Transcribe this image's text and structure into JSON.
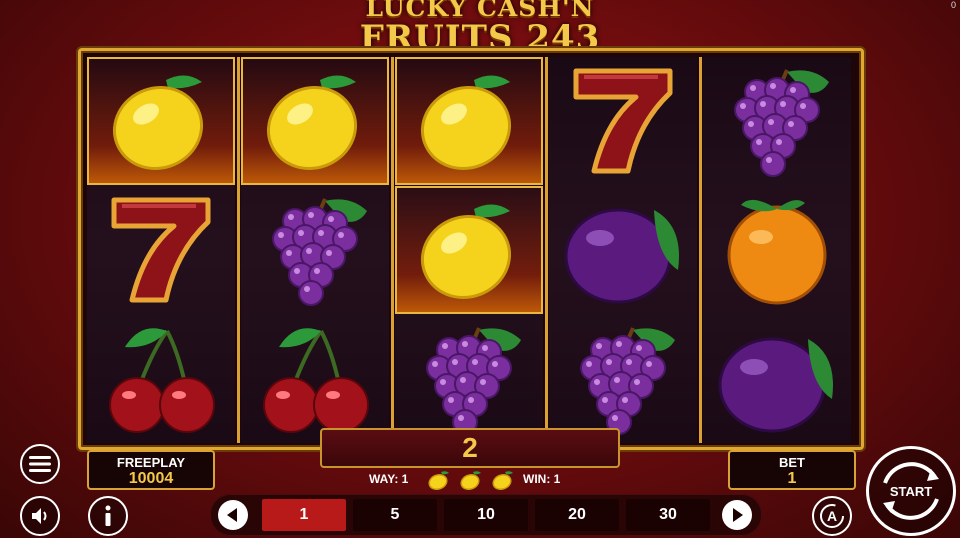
{
  "game": {
    "title_line1": "LUCKY CASH'N",
    "title_line2": "FRUITS 243",
    "corner_value": "0"
  },
  "reels": [
    {
      "symbols": [
        "lemon-icon",
        "seven-icon",
        "cherry-icon"
      ],
      "winning": [
        true,
        false,
        false
      ]
    },
    {
      "symbols": [
        "lemon-icon",
        "grapes-icon",
        "cherry-icon"
      ],
      "winning": [
        true,
        false,
        false
      ]
    },
    {
      "symbols": [
        "lemon-icon",
        "lemon-icon",
        "grapes-icon"
      ],
      "winning": [
        true,
        true,
        false
      ]
    },
    {
      "symbols": [
        "seven-icon",
        "plum-icon",
        "grapes-icon"
      ],
      "winning": [
        false,
        false,
        false
      ]
    },
    {
      "symbols": [
        "grapes-icon",
        "orange-icon",
        "plum-icon"
      ],
      "winning": [
        false,
        false,
        false
      ]
    }
  ],
  "win": {
    "amount": "2"
  },
  "win_info": {
    "way_label": "WAY: 1",
    "win_label": "WIN: 1",
    "symbol_count": 3
  },
  "freeplay": {
    "label": "FREEPLAY",
    "value": "10004"
  },
  "bet": {
    "label": "BET",
    "value": "1"
  },
  "bet_options": [
    {
      "label": "1",
      "active": true
    },
    {
      "label": "5",
      "active": false
    },
    {
      "label": "10",
      "active": false
    },
    {
      "label": "20",
      "active": false
    },
    {
      "label": "30",
      "active": false
    }
  ],
  "controls": {
    "start_label": "START",
    "menu_icon": "hamburger-menu-icon",
    "sound_icon": "speaker-icon",
    "info_icon": "info-icon",
    "autoplay_icon": "autoplay-icon"
  },
  "colors": {
    "gold": "#f4c94a",
    "frame": "#d9a235",
    "active_bet": "#b81a1a",
    "background": "#7a0e10"
  }
}
